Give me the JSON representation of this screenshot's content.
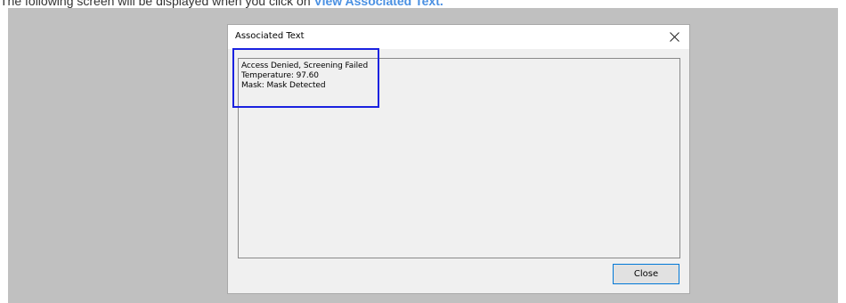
{
  "caption": {
    "text": "The following screen will be displayed when you click on ",
    "link": "View Associated Text."
  },
  "dialog": {
    "title": "Associated Text",
    "text_lines": [
      "Access Denied, Screening Failed",
      "Temperature: 97.60",
      "Mask: Mask Detected"
    ],
    "close_button_label": "Close"
  },
  "colors": {
    "highlight": "#1a22e0",
    "link": "#4a90e2",
    "backdrop": "#c0c0c0",
    "dialog_bg": "#f0f0f0"
  },
  "icons": {
    "dialog_close": "close-icon"
  }
}
